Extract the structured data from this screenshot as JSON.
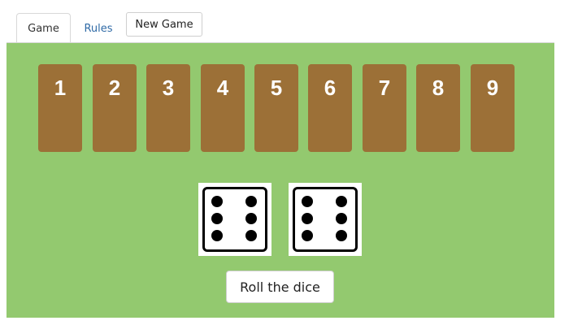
{
  "tabs": {
    "game_label": "Game",
    "rules_label": "Rules",
    "new_game_label": "New Game"
  },
  "tiles": [
    "1",
    "2",
    "3",
    "4",
    "5",
    "6",
    "7",
    "8",
    "9"
  ],
  "dice": [
    {
      "value": 6
    },
    {
      "value": 6
    }
  ],
  "roll_button_label": "Roll the dice",
  "colors": {
    "board": "#93c96f",
    "tile": "#9c7037",
    "tile_text": "#ffffff",
    "link": "#2f6aa6"
  }
}
